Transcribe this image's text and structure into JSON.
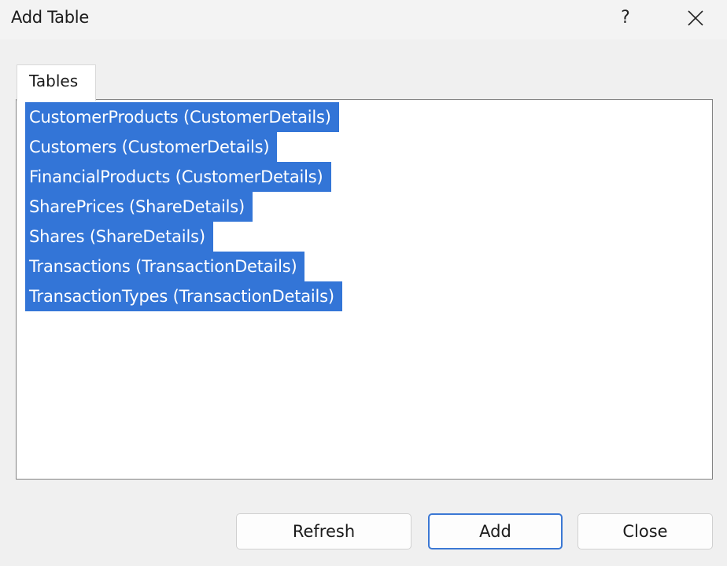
{
  "window": {
    "title": "Add Table",
    "help_glyph": "?"
  },
  "tabs": [
    {
      "label": "Tables",
      "selected": true
    }
  ],
  "tables": [
    {
      "label": "CustomerProducts (CustomerDetails)",
      "selected": true
    },
    {
      "label": "Customers (CustomerDetails)",
      "selected": true
    },
    {
      "label": "FinancialProducts (CustomerDetails)",
      "selected": true
    },
    {
      "label": "SharePrices (ShareDetails)",
      "selected": true
    },
    {
      "label": "Shares (ShareDetails)",
      "selected": true
    },
    {
      "label": "Transactions (TransactionDetails)",
      "selected": true
    },
    {
      "label": "TransactionTypes (TransactionDetails)",
      "selected": true
    }
  ],
  "buttons": {
    "refresh_label": "Refresh",
    "add_label": "Add",
    "close_label": "Close"
  },
  "colors": {
    "selection": "#3375d7",
    "default_button_border": "#3b78d4",
    "window_background": "#f0f0f0"
  }
}
